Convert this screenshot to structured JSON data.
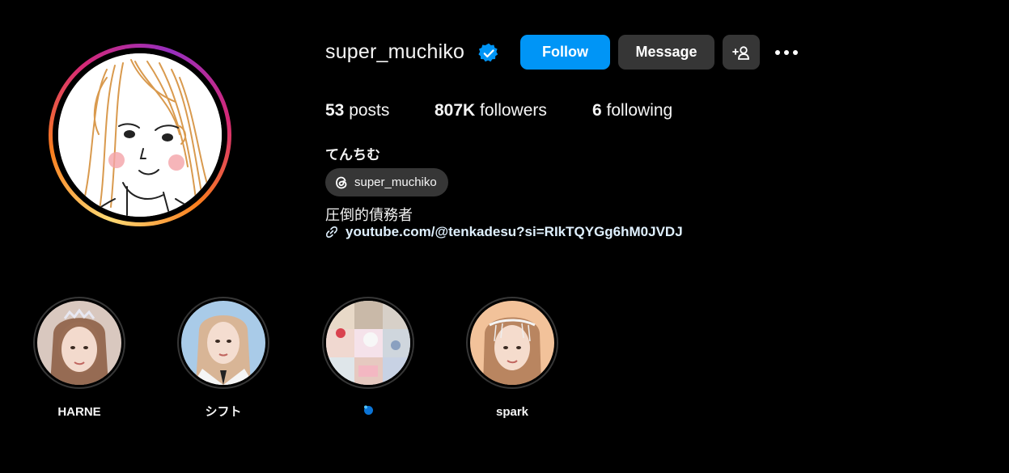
{
  "profile": {
    "username": "super_muchiko",
    "verified_icon": "verified-badge-icon",
    "buttons": {
      "follow_label": "Follow",
      "message_label": "Message",
      "suggest_icon": "add-person-icon",
      "more_icon": "more-options-icon"
    },
    "stats": {
      "posts_count": "53",
      "posts_label": " posts",
      "followers_count": "807K",
      "followers_label": " followers",
      "following_count": "6",
      "following_label": " following"
    },
    "full_name": "てんちむ",
    "threads_handle": "super_muchiko",
    "bio": "圧倒的債務者",
    "link": "youtube.com/@tenkadesu?si=RIkTQYGg6hM0JVDJ"
  },
  "highlights": [
    {
      "label": "HARNE"
    },
    {
      "label": "シフト"
    },
    {
      "label": ""
    },
    {
      "label": "spark"
    }
  ],
  "colors": {
    "background": "#000000",
    "follow_button": "#0095f6",
    "secondary_button": "#363636",
    "verified": "#0095f6",
    "link": "#e0f1ff"
  }
}
